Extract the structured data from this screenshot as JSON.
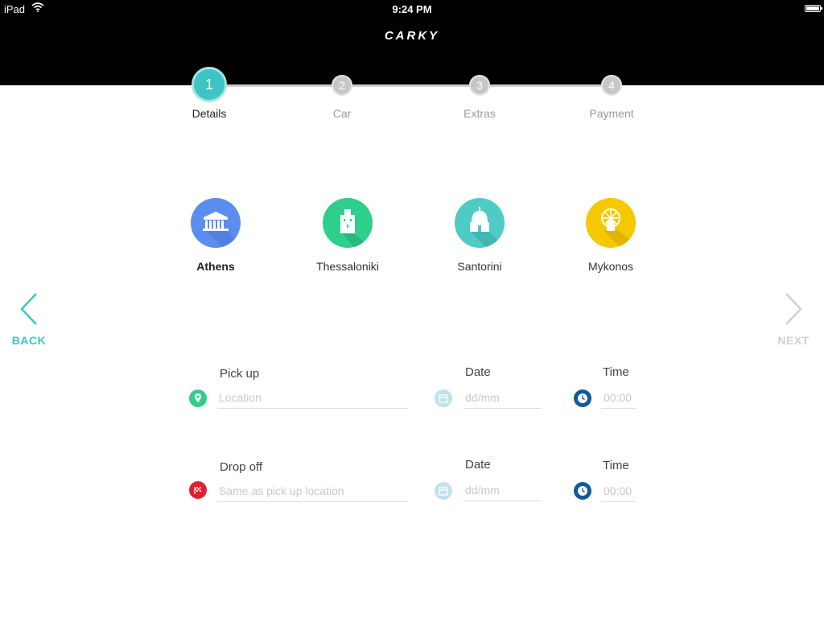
{
  "status_bar": {
    "device": "iPad",
    "time": "9:24 PM"
  },
  "header": {
    "logo_text": "CARKY"
  },
  "steps": [
    {
      "number": "1",
      "label": "Details",
      "active": true
    },
    {
      "number": "2",
      "label": "Car",
      "active": false
    },
    {
      "number": "3",
      "label": "Extras",
      "active": false
    },
    {
      "number": "4",
      "label": "Payment",
      "active": false
    }
  ],
  "cities": [
    {
      "name": "Athens",
      "icon": "parthenon-icon",
      "color": "#5b8def",
      "selected": true
    },
    {
      "name": "Thessaloniki",
      "icon": "white-tower-icon",
      "color": "#2ecf8a",
      "selected": false
    },
    {
      "name": "Santorini",
      "icon": "dome-church-icon",
      "color": "#4fcbc6",
      "selected": false
    },
    {
      "name": "Mykonos",
      "icon": "windmill-icon",
      "color": "#f5c900",
      "selected": false
    }
  ],
  "nav": {
    "back_label": "BACK",
    "next_label": "NEXT"
  },
  "pickup": {
    "title": "Pick up",
    "location_placeholder": "Location",
    "date_title": "Date",
    "date_placeholder": "dd/mm",
    "time_title": "Time",
    "time_placeholder": "00:00"
  },
  "dropoff": {
    "title": "Drop off",
    "location_placeholder": "Same as pick up location",
    "date_title": "Date",
    "date_placeholder": "dd/mm",
    "time_title": "Time",
    "time_placeholder": "00:00"
  },
  "colors": {
    "accent": "#3ec4c4",
    "pickup_marker": "#2ecf8a",
    "dropoff_marker": "#e02030",
    "clock": "#0f5a9a",
    "calendar": "#bfe3ea"
  }
}
